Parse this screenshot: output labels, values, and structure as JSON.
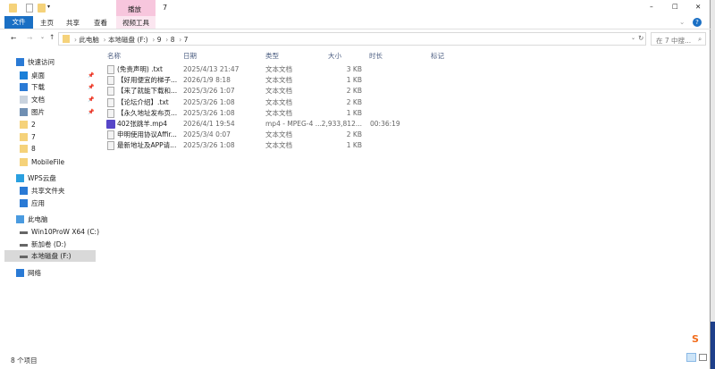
{
  "window": {
    "title": "7",
    "context_tab": "播放",
    "context_subtab": "视频工具",
    "controls": {
      "minimize": "–",
      "maximize": "☐",
      "close": "✕"
    }
  },
  "ribbon": {
    "tabs": [
      "文件",
      "主页",
      "共享",
      "查看"
    ]
  },
  "address": {
    "crumbs": [
      "此电脑",
      "本地磁盘 (F:)",
      "9",
      "8",
      "7"
    ],
    "search_placeholder": "在 7 中搜..."
  },
  "sidebar": {
    "items": [
      {
        "label": "快速访问",
        "icon": "star-icon",
        "color": "#2a7ad5"
      },
      {
        "label": "桌面",
        "icon": "desktop-icon",
        "color": "#1a7fd8",
        "pinned": true
      },
      {
        "label": "下载",
        "icon": "download-icon",
        "color": "#2a7ad5",
        "pinned": true
      },
      {
        "label": "文档",
        "icon": "document-icon",
        "color": "#c9d3de",
        "pinned": true
      },
      {
        "label": "图片",
        "icon": "pictures-icon",
        "color": "#6f8fb3",
        "pinned": true
      },
      {
        "label": "2",
        "icon": "folder-icon",
        "color": "#f5d27a"
      },
      {
        "label": "7",
        "icon": "folder-icon",
        "color": "#f5d27a"
      },
      {
        "label": "8",
        "icon": "folder-icon",
        "color": "#f5d27a"
      },
      {
        "label": "MobileFile",
        "icon": "folder-icon",
        "color": "#f5d27a"
      },
      {
        "label": "WPS云盘",
        "icon": "cloud-icon",
        "color": "#2aa0e0"
      },
      {
        "label": "共享文件夹",
        "icon": "share-icon",
        "color": "#2a7ad5"
      },
      {
        "label": "应用",
        "icon": "apps-icon",
        "color": "#2a7ad5"
      },
      {
        "label": "此电脑",
        "icon": "computer-icon",
        "color": "#4a9be0"
      },
      {
        "label": "Win10ProW X64 (C:)",
        "icon": "drive-icon",
        "color": "#666"
      },
      {
        "label": "新加卷 (D:)",
        "icon": "drive-icon",
        "color": "#666"
      },
      {
        "label": "本地磁盘 (F:)",
        "icon": "drive-icon",
        "color": "#666",
        "selected": true
      },
      {
        "label": "网络",
        "icon": "network-icon",
        "color": "#2a7ad5"
      }
    ]
  },
  "columns": [
    "名称",
    "日期",
    "类型",
    "大小",
    "时长",
    "标记"
  ],
  "files": [
    {
      "name": "(免责声明) .txt",
      "date": "2025/4/13 21:47",
      "type": "文本文档",
      "size": "3 KB",
      "duration": ""
    },
    {
      "name": "【好用便宜的梯子...",
      "date": "2026/1/9 8:18",
      "type": "文本文档",
      "size": "1 KB",
      "duration": ""
    },
    {
      "name": "【来了就能下载和...",
      "date": "2025/3/26 1:07",
      "type": "文本文档",
      "size": "2 KB",
      "duration": ""
    },
    {
      "name": "【论坛介绍】.txt",
      "date": "2025/3/26 1:08",
      "type": "文本文档",
      "size": "2 KB",
      "duration": ""
    },
    {
      "name": "【永久地址发布页...",
      "date": "2025/3/26 1:08",
      "type": "文本文档",
      "size": "1 KB",
      "duration": ""
    },
    {
      "name": "402张跳羊.mp4",
      "date": "2026/4/1 19:54",
      "type": "mp4 - MPEG-4 ...",
      "size": "2,933,812...",
      "duration": "00:36:19",
      "video": true
    },
    {
      "name": "申明使用协议Affir...",
      "date": "2025/3/4 0:07",
      "type": "文本文档",
      "size": "2 KB",
      "duration": ""
    },
    {
      "name": "最新地址及APP请...",
      "date": "2025/3/26 1:08",
      "type": "文本文档",
      "size": "1 KB",
      "duration": ""
    }
  ],
  "status": {
    "count": "8 个项目"
  },
  "tray": {
    "ime_label": "S"
  }
}
